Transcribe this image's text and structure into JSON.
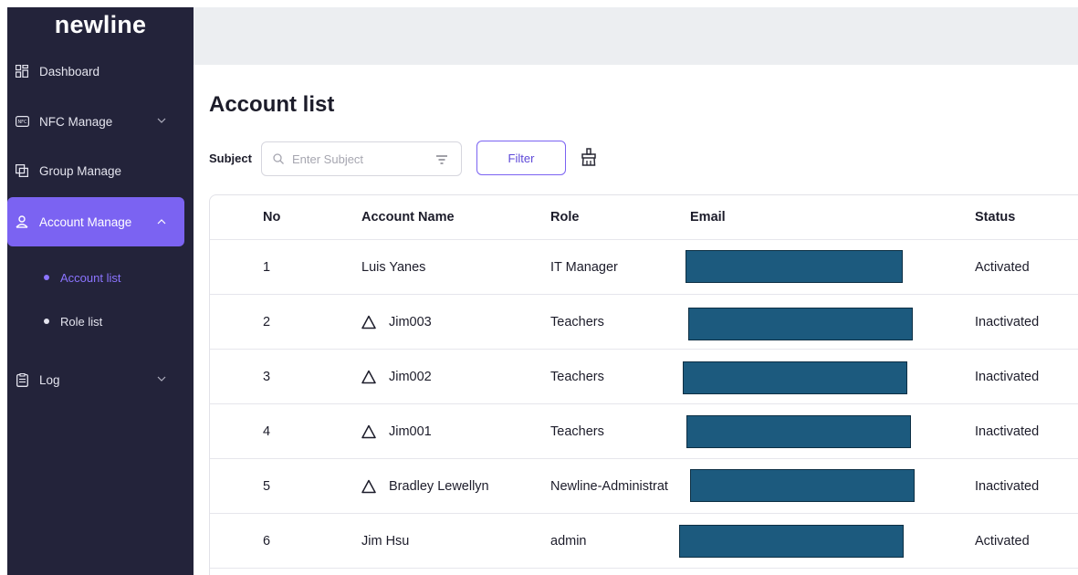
{
  "app": {
    "logo": "newline"
  },
  "sidebar": {
    "items": [
      {
        "label": "Dashboard",
        "icon": "dashboard-icon"
      },
      {
        "label": "NFC Manage",
        "icon": "nfc-icon"
      },
      {
        "label": "Group Manage",
        "icon": "group-icon"
      },
      {
        "label": "Account Manage",
        "icon": "user-icon",
        "active": true
      },
      {
        "label": "Log",
        "icon": "log-icon"
      }
    ],
    "sub_items": [
      {
        "label": "Account list",
        "active": true
      },
      {
        "label": "Role list"
      }
    ]
  },
  "page": {
    "title": "Account list"
  },
  "search": {
    "label": "Subject",
    "placeholder": "Enter Subject",
    "filter_label": "Filter"
  },
  "table": {
    "headers": {
      "no": "No",
      "name": "Account Name",
      "role": "Role",
      "email": "Email",
      "status": "Status"
    },
    "rows": [
      {
        "no": "1",
        "name": "Luis Yanes",
        "role": "IT Manager",
        "status": "Activated",
        "warning": false
      },
      {
        "no": "2",
        "name": "Jim003",
        "role": "Teachers",
        "status": "Inactivated",
        "warning": true
      },
      {
        "no": "3",
        "name": "Jim002",
        "role": "Teachers",
        "status": "Inactivated",
        "warning": true
      },
      {
        "no": "4",
        "name": "Jim001",
        "role": "Teachers",
        "status": "Inactivated",
        "warning": true
      },
      {
        "no": "5",
        "name": "Bradley Lewellyn",
        "role": "Newline-Administrat",
        "status": "Inactivated",
        "warning": true
      },
      {
        "no": "6",
        "name": "Jim Hsu",
        "role": "admin",
        "status": "Activated",
        "warning": false
      }
    ]
  },
  "colors": {
    "accent": "#7b63f2",
    "sidebar_bg": "#23233a",
    "redaction": "#1c5a7e"
  }
}
